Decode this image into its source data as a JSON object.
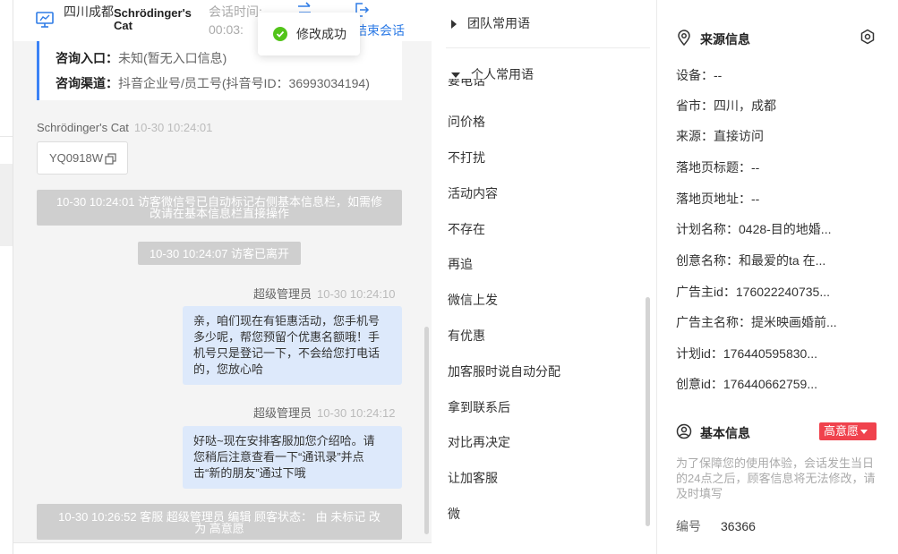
{
  "header": {
    "location": "四川成都",
    "visitor_name": "Schrödinger's Cat",
    "session_time_label": "会话时间:",
    "session_time_value": "00:03:",
    "end_session": "结束会话"
  },
  "toast": {
    "text": "修改成功"
  },
  "info_card": {
    "entry_label": "咨询入口：",
    "entry_value": "未知(暂无入口信息)",
    "channel_label": "咨询渠道：",
    "channel_value": "抖音企业号/员工号(抖音号ID：36993034194)"
  },
  "messages": {
    "m1_sender": "Schrödinger's Cat",
    "m1_time": "10-30 10:24:01",
    "m1_id": "YQ0918W",
    "sys1_line1": "10-30 10:24:01 访客微信号已自动标记右侧基本信息栏，如需修",
    "sys1_line2": "改请在基本信息栏直接操作",
    "sys2": "10-30 10:24:07 访客已离开",
    "m2_sender": "超级管理员",
    "m2_time": "10-30 10:24:10",
    "m2_line1": "亲，咱们现在有钜惠活动，您手机号",
    "m2_line2": "多少呢，帮您预留个优惠名额哦！手",
    "m2_line3": "机号只是登记一下，不会给您打电话",
    "m2_line4": "的，您放心哈",
    "m3_sender": "超级管理员",
    "m3_time": "10-30 10:24:12",
    "m3_line1": "好哒~现在安排客服加您介绍哈。请",
    "m3_line2": "您稍后注意查看一下“通讯录”并点",
    "m3_line3": "击“新的朋友”通过下哦",
    "sys3_line1": "10-30 10:26:52 客服 超级管理员 编辑 顾客状态： 由 未标记 改",
    "sys3_line2": "为 高意愿"
  },
  "phrases": {
    "team_group": "团队常用语",
    "personal_group": "个人常用语",
    "clipped_item": "要电话",
    "items": [
      "问价格",
      "不打扰",
      "活动内容",
      "不存在",
      "再追",
      "微信上发",
      "有优惠",
      "加客服时说自动分配",
      "拿到联系后",
      "对比再决定",
      "让加客服",
      "微"
    ]
  },
  "source_info": {
    "title": "来源信息",
    "device": "设备：--",
    "province": "省市：四川，成都",
    "source": "来源：直接访问",
    "landing_title": "落地页标题：--",
    "landing_url": "落地页地址：--",
    "plan_name": "计划名称：0428-目的地婚...",
    "creative_name": "创意名称：和最爱的ta 在...",
    "advertiser_id": "广告主id：176022240735...",
    "advertiser_name": "广告主名称：提米映画婚前...",
    "plan_id": "计划id：176440595830...",
    "creative_id": "创意id：176440662759..."
  },
  "basic_info": {
    "title": "基本信息",
    "intent_badge": "高意愿",
    "note": "为了保障您的使用体验，会话发生当日的24点之后，顾客信息将无法修改，请及时填写",
    "code_label": "编号",
    "code_value": "36366"
  },
  "colors": {
    "accent": "#2f7ce6",
    "bubble": "#dde9fb",
    "system": "#cfcfcf",
    "badge": "#f0424d",
    "success": "#52c41a"
  }
}
